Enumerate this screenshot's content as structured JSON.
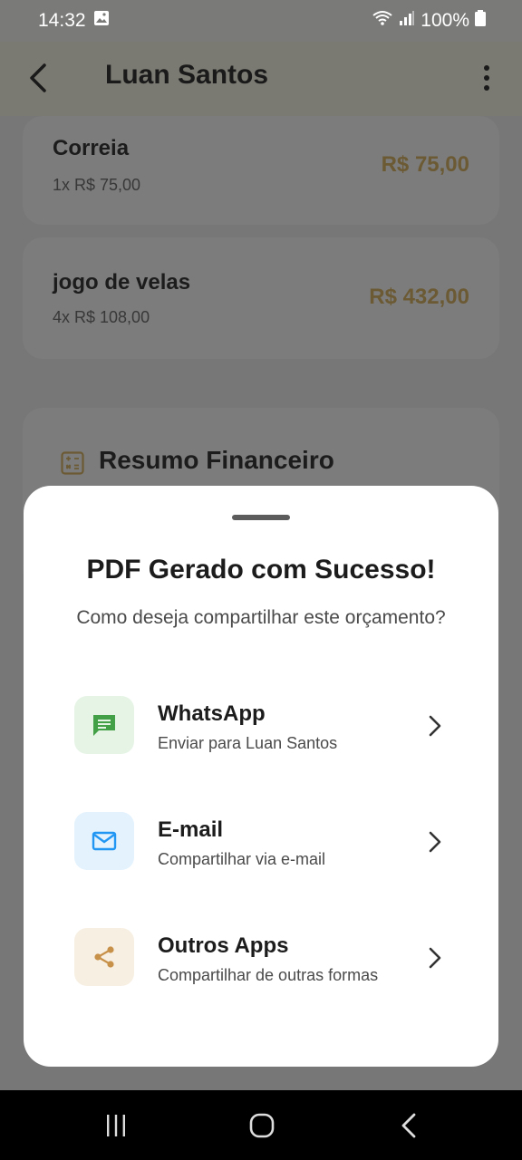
{
  "status_bar": {
    "time": "14:32",
    "battery": "100%",
    "icons": [
      "image-icon",
      "wifi-icon",
      "signal-icon",
      "battery-icon"
    ]
  },
  "app_bar": {
    "title": "Luan Santos",
    "back_icon": "arrow-back-icon",
    "menu_icon": "more-vert-icon"
  },
  "items": [
    {
      "name": "Correia",
      "detail": "1x R$ 75,00",
      "price": "R$ 75,00"
    },
    {
      "name": "jogo de velas",
      "detail": "4x R$ 108,00",
      "price": "R$ 432,00"
    }
  ],
  "summary": {
    "title": "Resumo Financeiro",
    "icon": "calculator-icon"
  },
  "sheet": {
    "title": "PDF Gerado com Sucesso!",
    "subtitle": "Como deseja compartilhar este orçamento?",
    "options": [
      {
        "title": "WhatsApp",
        "subtitle": "Enviar para Luan Santos",
        "icon": "message-icon",
        "icon_color": "#43a047",
        "bg_color": "#e6f4e6"
      },
      {
        "title": "E-mail",
        "subtitle": "Compartilhar via e-mail",
        "icon": "mail-icon",
        "icon_color": "#2196f3",
        "bg_color": "#e3f2fd"
      },
      {
        "title": "Outros Apps",
        "subtitle": "Compartilhar de outras formas",
        "icon": "share-icon",
        "icon_color": "#c8914a",
        "bg_color": "#f7efe2"
      }
    ]
  },
  "colors": {
    "price": "#8a7442",
    "accent": "#c8914a"
  },
  "nav_bar": {
    "icons": [
      "recent-apps-icon",
      "home-icon",
      "back-icon"
    ]
  }
}
